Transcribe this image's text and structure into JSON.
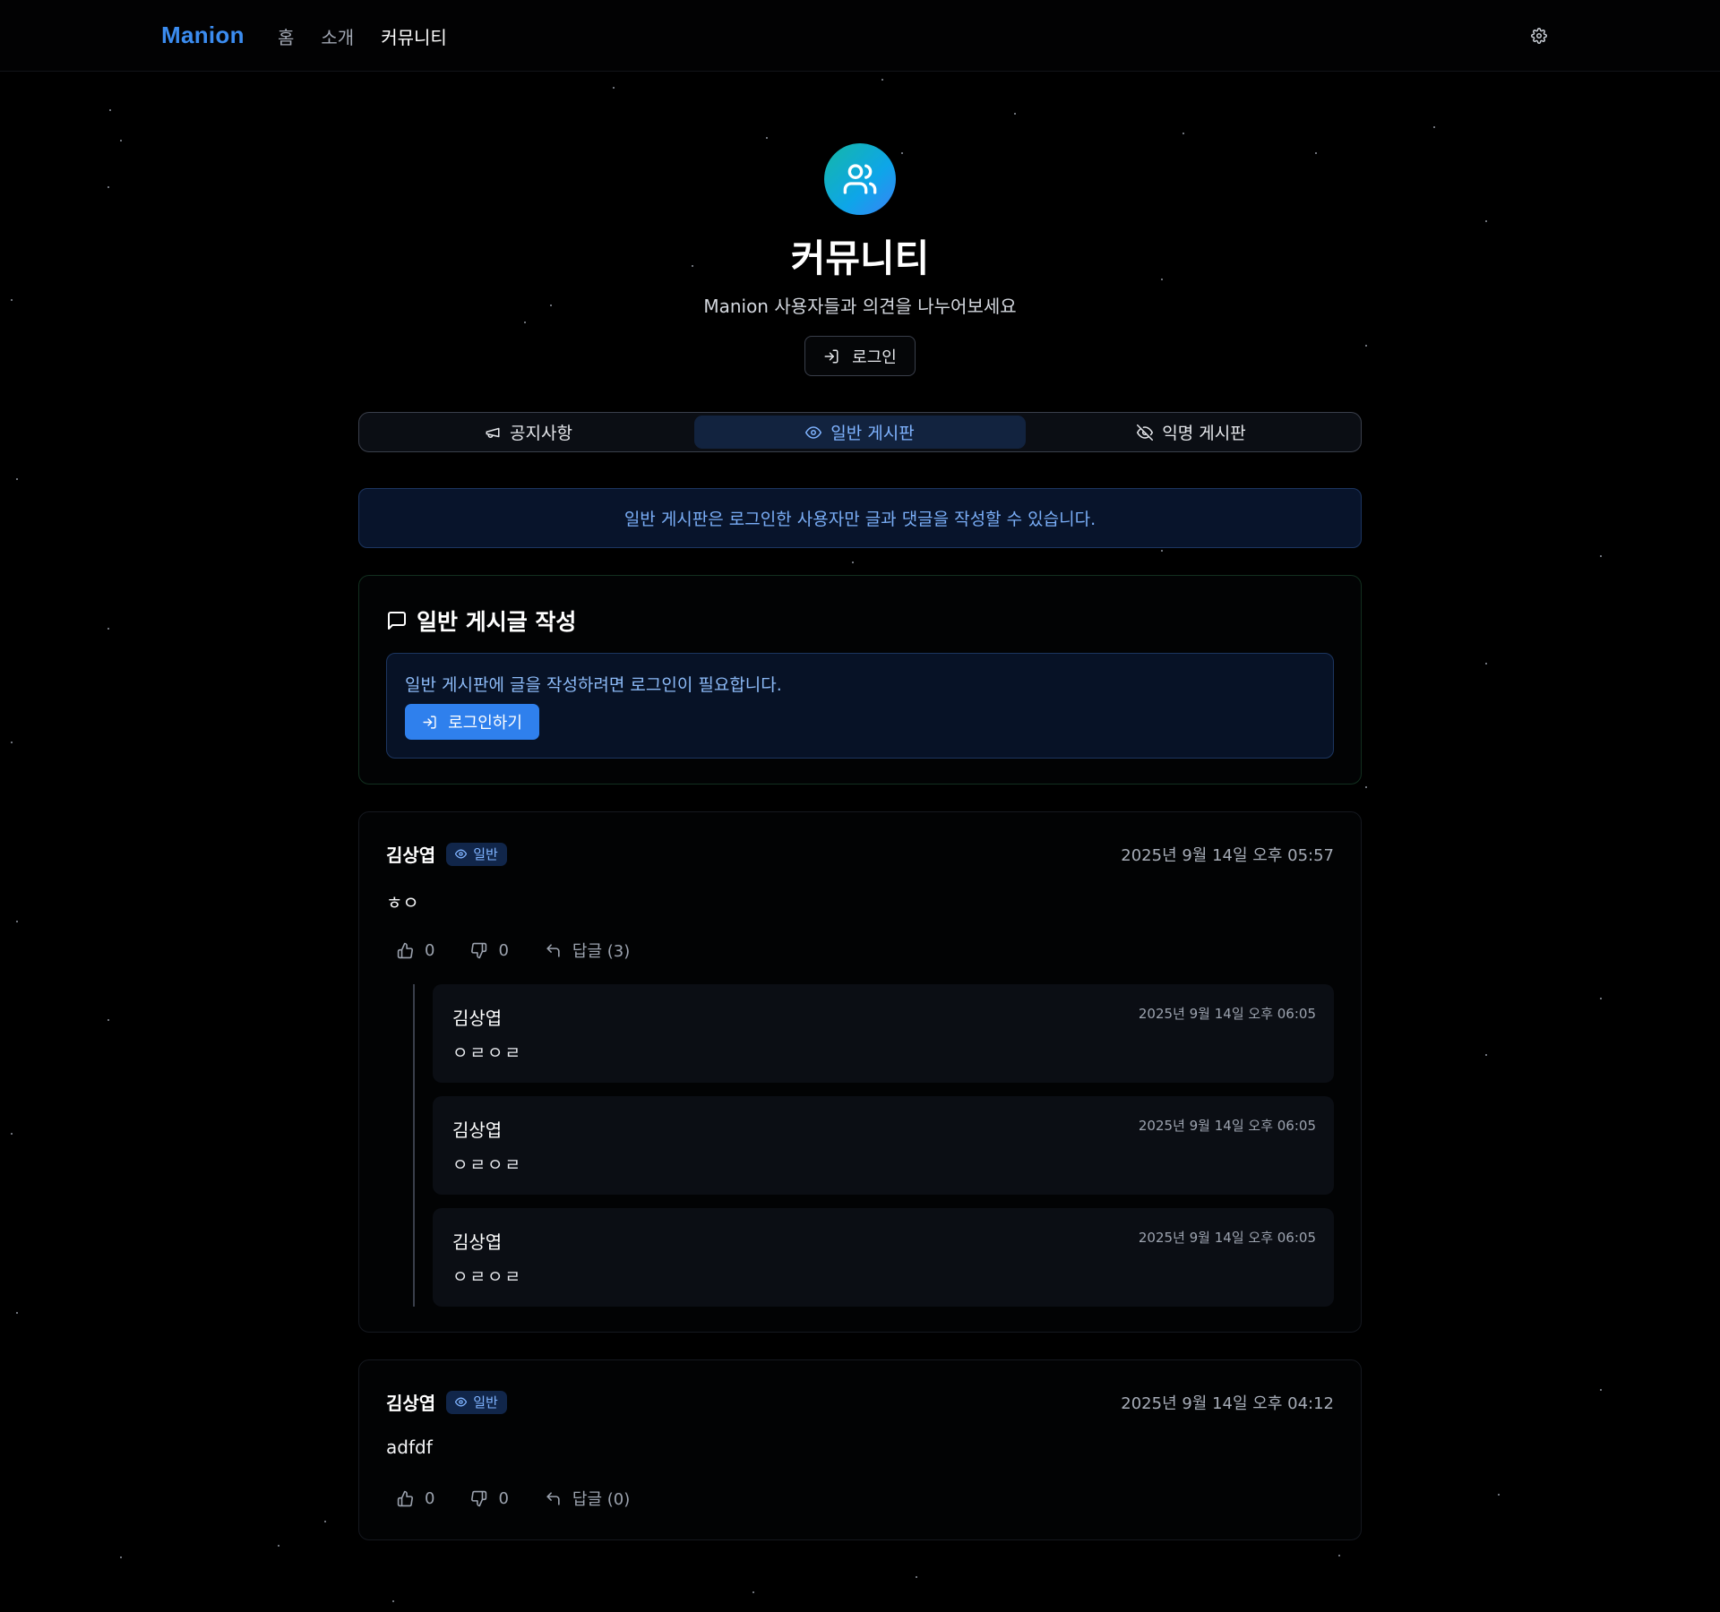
{
  "nav": {
    "brand": "Manion",
    "links": [
      {
        "label": "홈",
        "active": false
      },
      {
        "label": "소개",
        "active": false
      },
      {
        "label": "커뮤니티",
        "active": true
      }
    ],
    "settings_icon": "gear-icon"
  },
  "hero": {
    "icon": "users-icon",
    "title": "커뮤니티",
    "subtitle": "Manion 사용자들과 의견을 나누어보세요",
    "login_label": "로그인"
  },
  "tabs": [
    {
      "label": "공지사항",
      "icon": "megaphone-icon",
      "active": false
    },
    {
      "label": "일반 게시판",
      "icon": "eye-icon",
      "active": true
    },
    {
      "label": "익명 게시판",
      "icon": "eye-off-icon",
      "active": false
    }
  ],
  "notice": "일반 게시판은 로그인한 사용자만 글과 댓글을 작성할 수 있습니다.",
  "write": {
    "title": "일반 게시글 작성",
    "message": "일반 게시판에 글을 작성하려면 로그인이 필요합니다.",
    "login_button": "로그인하기"
  },
  "posts": [
    {
      "author": "김상엽",
      "badge": "일반",
      "date": "2025년 9월 14일 오후 05:57",
      "content": "ㅎㅇ",
      "likes": "0",
      "dislikes": "0",
      "reply_label": "답글 (3)",
      "replies": [
        {
          "author": "김상엽",
          "date": "2025년 9월 14일 오후 06:05",
          "content": "ㅇㄹㅇㄹ"
        },
        {
          "author": "김상엽",
          "date": "2025년 9월 14일 오후 06:05",
          "content": "ㅇㄹㅇㄹ"
        },
        {
          "author": "김상엽",
          "date": "2025년 9월 14일 오후 06:05",
          "content": "ㅇㄹㅇㄹ"
        }
      ]
    },
    {
      "author": "김상엽",
      "badge": "일반",
      "date": "2025년 9월 14일 오후 04:12",
      "content": "adfdf",
      "likes": "0",
      "dislikes": "0",
      "reply_label": "답글 (0)",
      "replies": []
    }
  ],
  "colors": {
    "accent": "#3b8cf0",
    "button_primary": "#2f80ed",
    "tab_active_bg": "#12233f",
    "notice_text": "#7aaef7"
  }
}
